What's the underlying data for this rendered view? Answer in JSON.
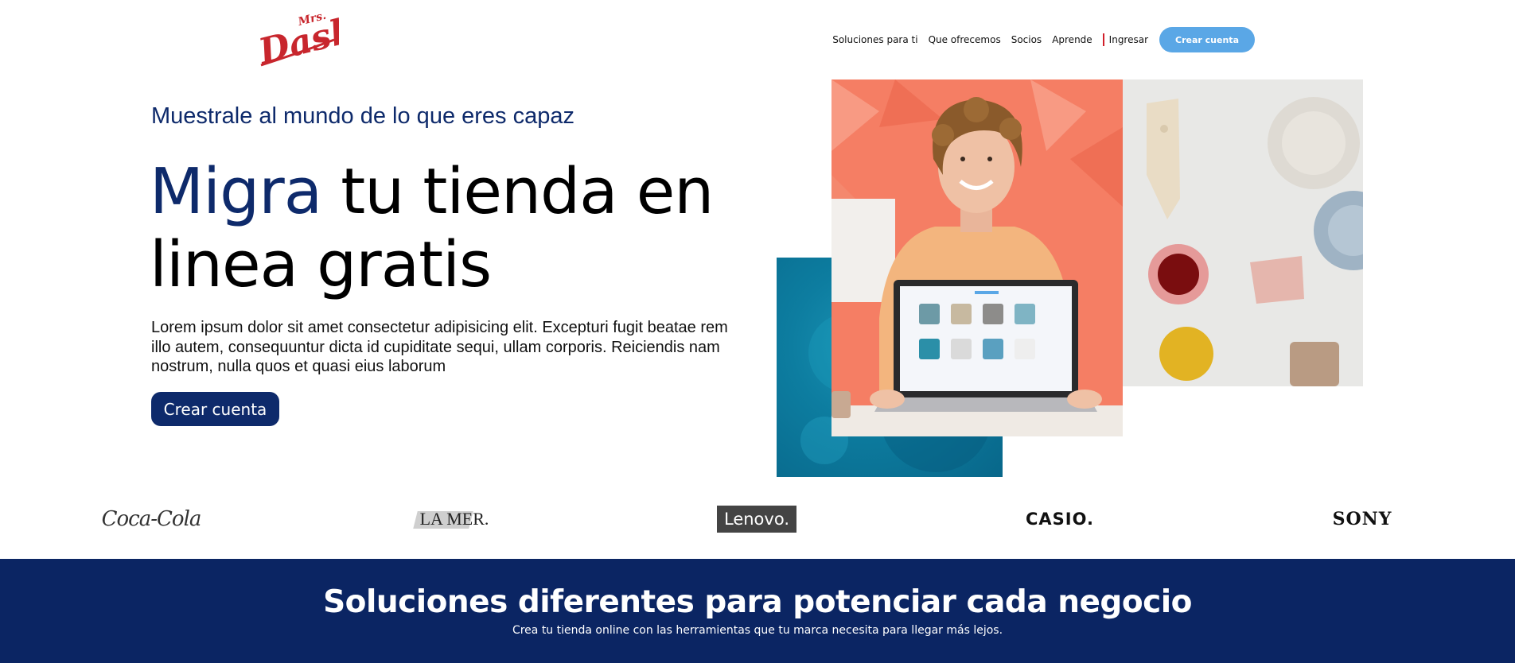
{
  "brand": {
    "logo_small": "Mrs.",
    "logo_main": "Dash"
  },
  "nav": {
    "items": [
      "Soluciones para ti",
      "Que ofrecemos",
      "Socios",
      "Aprende",
      "Ingresar"
    ],
    "cta": "Crear cuenta"
  },
  "hero": {
    "eyebrow": "Muestrale al mundo de lo que eres capaz",
    "headline_accent": "Migra",
    "headline_line1_rest": " tu tienda en",
    "headline_line2": "linea gratis",
    "body": "Lorem ipsum dolor sit amet consectetur adipisicing elit. Excepturi fugit beatae rem illo autem, consequuntur dicta id cupiditate sequi, ullam corporis. Reiciendis nam nostrum, nulla quos et quasi eius laborum",
    "cta": "Crear cuenta"
  },
  "logos": [
    "Coca-Cola",
    "LA MER.",
    "Lenovo.",
    "CASIO.",
    "SONY"
  ],
  "solutions": {
    "title": "Soluciones diferentes para potenciar cada negocio",
    "subtitle": "Crea tu tienda online con las herramientas que tu marca necesita para llegar más lejos."
  },
  "colors": {
    "navy": "#0e2a6b",
    "band": "#0b2563",
    "nav_button": "#5aa7e6",
    "logo_red": "#c8262d"
  }
}
